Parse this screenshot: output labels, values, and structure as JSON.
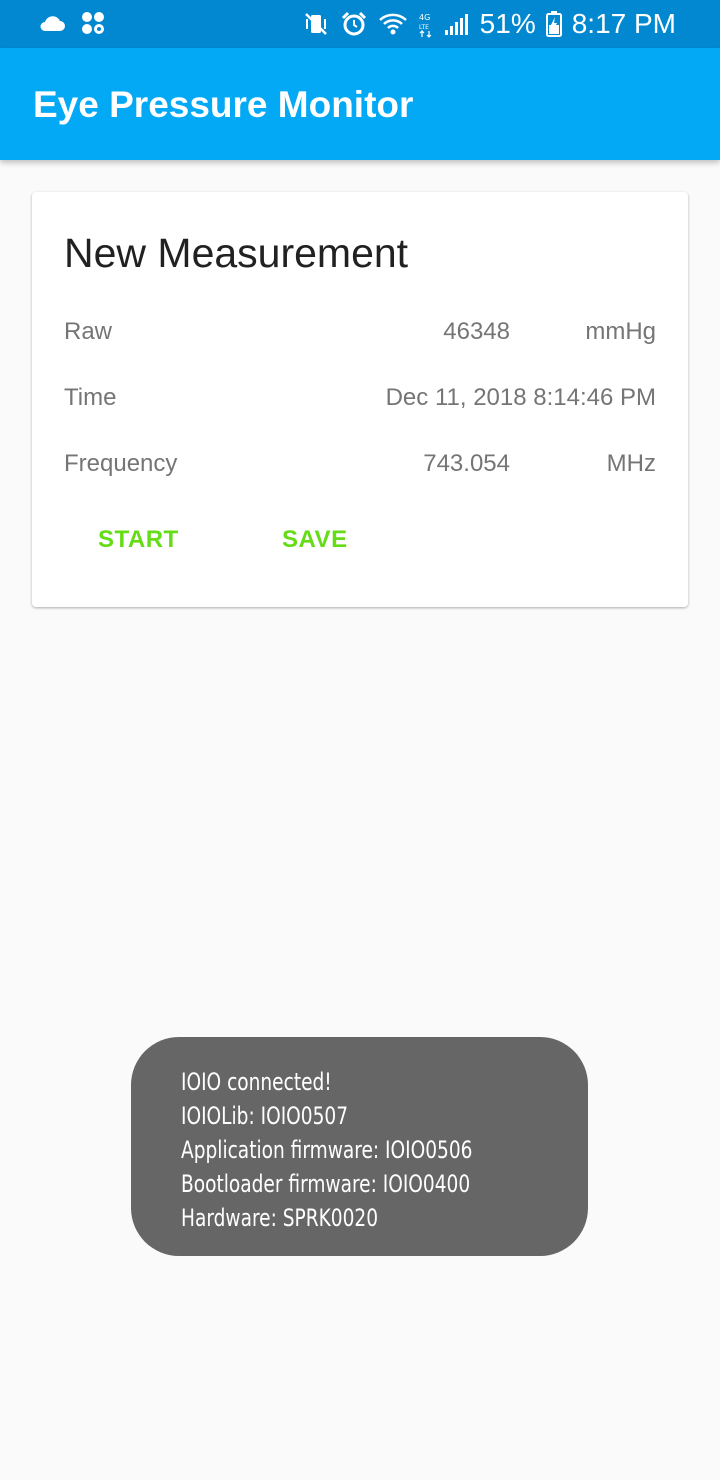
{
  "status_bar": {
    "left_icons": [
      "cloud-icon",
      "app-notification-icon"
    ],
    "right_icons": [
      "vibrate-mute-icon",
      "alarm-icon",
      "wifi-icon",
      "lte-icon",
      "signal-icon",
      "battery-icon"
    ],
    "battery": "51%",
    "time": "8:17 PM"
  },
  "app_bar": {
    "title": "Eye Pressure Monitor"
  },
  "card": {
    "title": "New Measurement",
    "rows": [
      {
        "label": "Raw",
        "value": "46348",
        "unit": "mmHg"
      },
      {
        "label": "Time",
        "value": "Dec 11, 2018 8:14:46 PM"
      },
      {
        "label": "Frequency",
        "value": "743.054",
        "unit": "MHz"
      }
    ],
    "buttons": {
      "start": "START",
      "save": "SAVE"
    }
  },
  "toast": {
    "lines": [
      "IOIO connected!",
      "IOIOLib: IOIO0507",
      "Application firmware: IOIO0506",
      "Bootloader firmware: IOIO0400",
      "Hardware: SPRK0020"
    ]
  },
  "colors": {
    "status_bar": "#0288d1",
    "app_bar": "#03a9f4",
    "accent": "#64dd17",
    "toast_bg": "#666666",
    "background": "#fafafa"
  }
}
